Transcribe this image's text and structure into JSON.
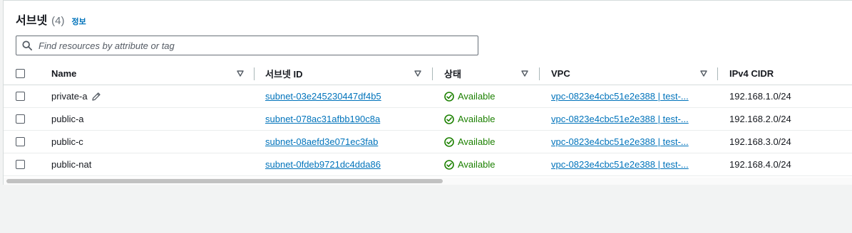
{
  "header": {
    "title": "서브넷",
    "count": "(4)",
    "info_link": "정보"
  },
  "search": {
    "placeholder": "Find resources by attribute or tag",
    "value": ""
  },
  "columns": [
    {
      "label": "Name"
    },
    {
      "label": "서브넷 ID"
    },
    {
      "label": "상태"
    },
    {
      "label": "VPC"
    },
    {
      "label": "IPv4 CIDR"
    }
  ],
  "rows": [
    {
      "name": "private-a",
      "subnet_id": "subnet-03e245230447df4b5",
      "status": "Available",
      "vpc": "vpc-0823e4cbc51e2e388 | test-...",
      "cidr": "192.168.1.0/24"
    },
    {
      "name": "public-a",
      "subnet_id": "subnet-078ac31afbb190c8a",
      "status": "Available",
      "vpc": "vpc-0823e4cbc51e2e388 | test-...",
      "cidr": "192.168.2.0/24"
    },
    {
      "name": "public-c",
      "subnet_id": "subnet-08aefd3e071ec3fab",
      "status": "Available",
      "vpc": "vpc-0823e4cbc51e2e388 | test-...",
      "cidr": "192.168.3.0/24"
    },
    {
      "name": "public-nat",
      "subnet_id": "subnet-0fdeb9721dc4dda86",
      "status": "Available",
      "vpc": "vpc-0823e4cbc51e2e388 | test-...",
      "cidr": "192.168.4.0/24"
    }
  ],
  "icons": {
    "search": "search-icon",
    "sort": "caret-down-icon",
    "status": "check-circle-icon",
    "edit": "pencil-icon"
  },
  "colors": {
    "link": "#0073bb",
    "available": "#1d8102"
  }
}
